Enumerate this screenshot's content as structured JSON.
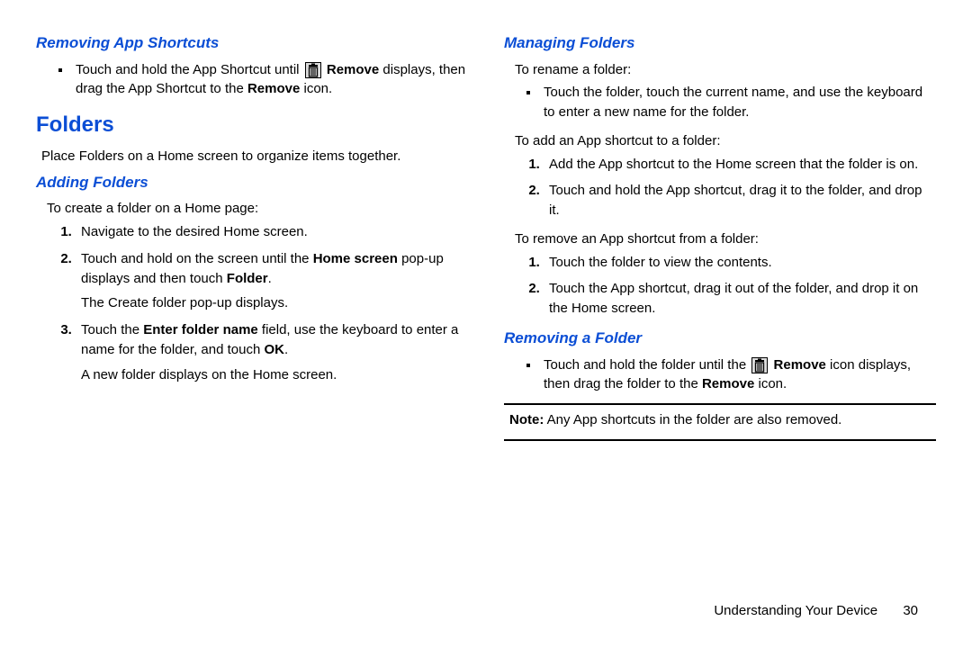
{
  "left": {
    "h_removing": "Removing App Shortcuts",
    "removing_bullet_pre": "Touch and hold the App Shortcut until ",
    "removing_bullet_icon_label": "Remove",
    "removing_bullet_mid": " displays, then drag the App Shortcut to the ",
    "removing_bullet_bold2": "Remove",
    "removing_bullet_post": " icon.",
    "h_folders": "Folders",
    "folders_intro": "Place Folders on a Home screen to organize items together.",
    "h_adding": "Adding Folders",
    "adding_intro": "To create a folder on a Home page:",
    "adding_step1": "Navigate to the desired Home screen.",
    "adding_step2_pre": "Touch and hold on the screen until the ",
    "adding_step2_bold1": "Home screen",
    "adding_step2_mid": " pop-up displays and then touch ",
    "adding_step2_bold2": "Folder",
    "adding_step2_post": ".",
    "adding_step2_tail": "The Create folder pop-up displays.",
    "adding_step3_pre": "Touch the ",
    "adding_step3_bold1": "Enter folder name",
    "adding_step3_mid": " field, use the keyboard to enter a name for the folder, and touch ",
    "adding_step3_bold2": "OK",
    "adding_step3_post": ".",
    "adding_step3_tail": "A new folder displays on the Home screen."
  },
  "right": {
    "h_managing": "Managing Folders",
    "rename_intro": "To rename a folder:",
    "rename_bullet": "Touch the folder, touch the current name, and use the keyboard to enter a new name for the folder.",
    "add_intro": "To add an App shortcut to a folder:",
    "add_step1": "Add the App shortcut to the Home screen that the folder is on.",
    "add_step2": "Touch and hold the App shortcut, drag it to the folder, and drop it.",
    "remove_intro": "To remove an App shortcut from a folder:",
    "remove_step1": "Touch the folder to view the contents.",
    "remove_step2": "Touch the App shortcut, drag it out of the folder, and drop it on the Home screen.",
    "h_removing_folder": "Removing a Folder",
    "rf_bullet_pre": "Touch and hold the folder until the ",
    "rf_bullet_icon_label": "Remove",
    "rf_bullet_mid": " icon displays, then drag the folder to the ",
    "rf_bullet_bold2": "Remove",
    "rf_bullet_post": " icon.",
    "note_bold": "Note:",
    "note_text": " Any App shortcuts in the folder are also removed."
  },
  "footer": {
    "section": "Understanding Your Device",
    "page": "30"
  }
}
